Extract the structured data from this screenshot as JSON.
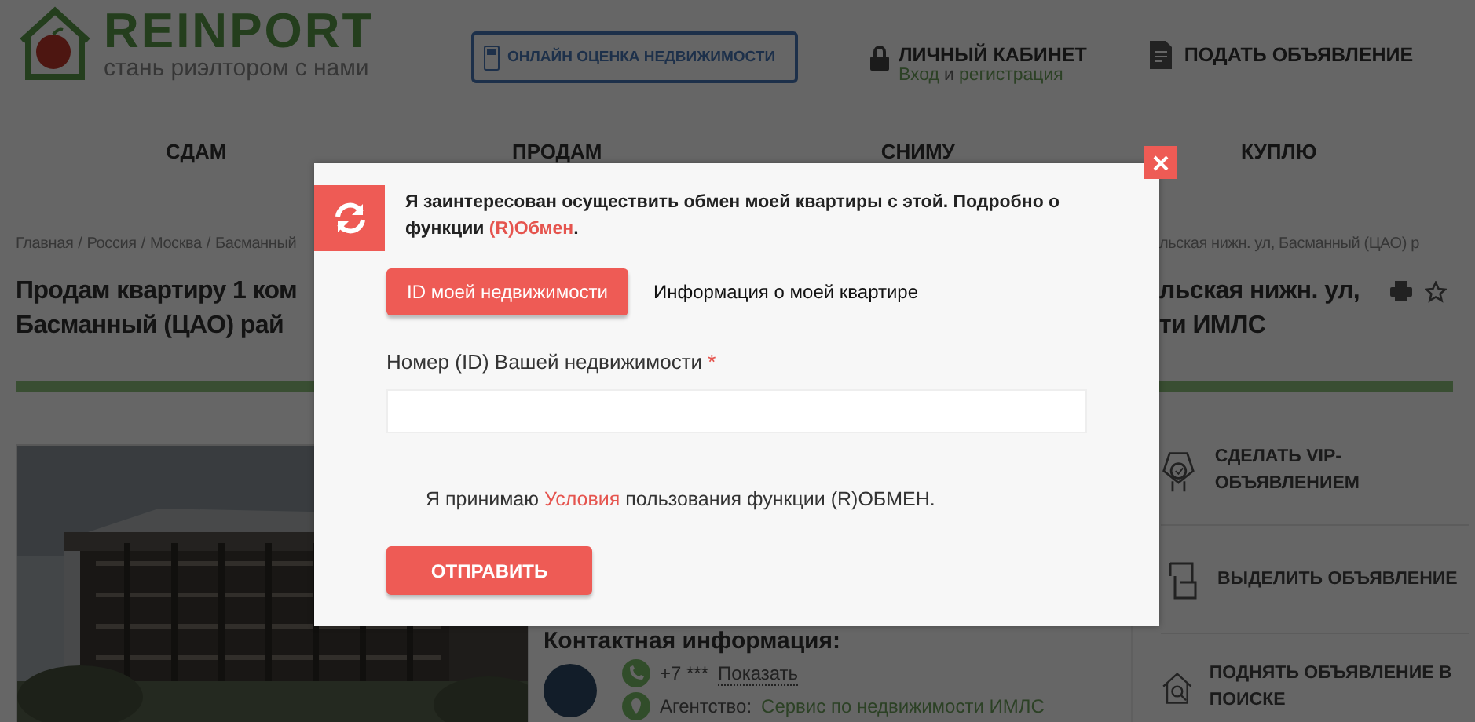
{
  "header": {
    "logo": {
      "name": "REINPORT",
      "tagline": "стань риэлтором с нами"
    },
    "evaluate_button": "ОНЛАЙН ОЦЕНКА НЕДВИЖИМОСТИ",
    "account": {
      "title": "ЛИЧНЫЙ КАБИНЕТ",
      "login": "Вход",
      "joiner": "и",
      "register": "регистрация"
    },
    "post_ad": "ПОДАТЬ ОБЪЯВЛЕНИЕ"
  },
  "nav": [
    {
      "label": "СДАМ"
    },
    {
      "label": "ПРОДАМ"
    },
    {
      "label": "СНИМУ"
    },
    {
      "label": "КУПЛЮ"
    }
  ],
  "breadcrumbs": {
    "separator": "/",
    "left": [
      "Главная",
      "Россия",
      "Москва",
      "Басманный"
    ],
    "right": "льская нижн. ул, Басманный (ЦАО) р"
  },
  "listing_title": {
    "left": [
      "Продам квартиру 1 ком",
      "Басманный (ЦАО) рай"
    ],
    "right": [
      "льская нижн. ул,",
      "ти ИМЛС"
    ]
  },
  "contact": {
    "heading": "Контактная информация:",
    "phone": "+7 ***",
    "show": "Показать",
    "agency_label": "Агентство:",
    "agency": "Сервис по недвижимости ИМЛС"
  },
  "promotions": [
    {
      "kind": "vip",
      "label": "СДЕЛАТЬ VIP-ОБЪЯВЛЕНИЕМ"
    },
    {
      "kind": "highlight",
      "label": "ВЫДЕЛИТЬ ОБЪЯВЛЕНИЕ"
    },
    {
      "kind": "raise",
      "label": "ПОДНЯТЬ ОБЪЯВЛЕНИЕ В ПОИСКЕ"
    }
  ],
  "modal": {
    "intro": {
      "text": "Я заинтересован осуществить обмен моей квартиры с этой. Подробно о функции ",
      "link": "(R)Обмен",
      "after": "."
    },
    "tabs": [
      {
        "label": "ID моей недвижимости",
        "selected": true
      },
      {
        "label": "Информация о моей квартире",
        "selected": false
      }
    ],
    "field": {
      "label": "Номер (ID) Вашей недвижимости",
      "required_mark": "*"
    },
    "terms": {
      "before": "Я принимаю ",
      "link": "Условия",
      "after": " пользования функции (R)ОБМЕН."
    },
    "submit": "ОТПРАВИТЬ"
  }
}
